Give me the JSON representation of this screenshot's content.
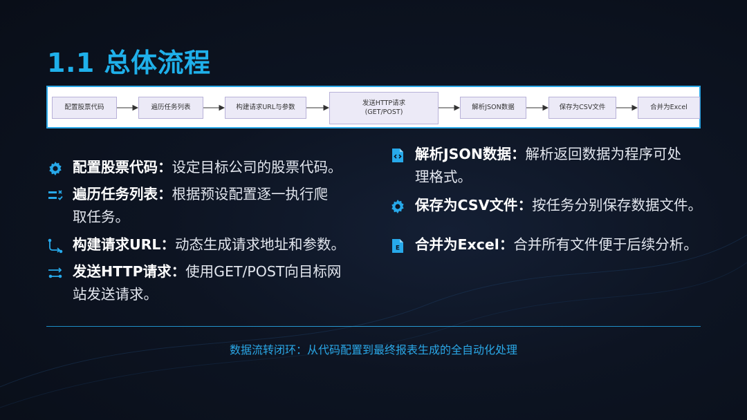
{
  "slide": {
    "title": "1.1 总体流程",
    "flow": {
      "nodes": [
        {
          "lines": [
            "配置股票代码"
          ]
        },
        {
          "lines": [
            "遍历任务列表"
          ]
        },
        {
          "lines": [
            "构建请求URL与参数"
          ]
        },
        {
          "lines": [
            "发送HTTP请求",
            "(GET/POST)"
          ]
        },
        {
          "lines": [
            "解析JSON数据"
          ]
        },
        {
          "lines": [
            "保存为CSV文件"
          ]
        },
        {
          "lines": [
            "合并为Excel"
          ]
        }
      ]
    },
    "items_left": [
      {
        "icon": "gear-icon",
        "title": "配置股票代码",
        "sep": "：",
        "desc_lines": [
          "设定目标公司的股票代码。"
        ]
      },
      {
        "icon": "checklist-icon",
        "title": "遍历任务列表",
        "sep": "：",
        "desc_lines": [
          "根据预设配置逐一执行爬",
          "取任务。"
        ]
      },
      {
        "icon": "route-icon",
        "title": "构建请求URL",
        "sep": "：",
        "desc_lines": [
          "动态生成请求地址和参数。"
        ]
      },
      {
        "icon": "send-icon",
        "title": "发送HTTP请求",
        "sep": "：",
        "desc_lines": [
          "使用GET/POST向目标网",
          "站发送请求。"
        ]
      }
    ],
    "items_right": [
      {
        "icon": "code-file-icon",
        "title": "解析JSON数据",
        "sep": "：",
        "desc_lines": [
          "解析返回数据为程序可处",
          "理格式。"
        ]
      },
      {
        "icon": "gear-icon",
        "title": "保存为CSV文件",
        "sep": "：",
        "desc_lines": [
          "按任务分别保存数据文件。"
        ]
      },
      {
        "icon": "excel-file-icon",
        "title": "合并为Excel",
        "sep": "：",
        "desc_lines": [
          "合并所有文件便于后续分析。"
        ]
      }
    ],
    "footer": "数据流转闭环：从代码配置到最终报表生成的全自动化处理",
    "colors": {
      "accent": "#1fb0ea",
      "background": "#0d1422",
      "node_fill": "#eceaf7",
      "node_border": "#b8b1d8"
    }
  }
}
